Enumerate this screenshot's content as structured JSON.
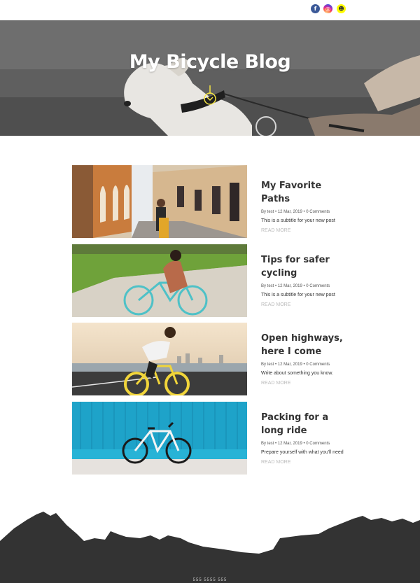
{
  "social": [
    {
      "name": "facebook",
      "glyph": "f"
    },
    {
      "name": "instagram",
      "glyph": "◎"
    },
    {
      "name": "snapchat",
      "glyph": "☻"
    }
  ],
  "hero": {
    "title": "My Bicycle Blog",
    "scroll_icon": "scroll-down-icon"
  },
  "posts": [
    {
      "title": "My Favorite Paths",
      "meta": "By test • 12 Mar, 2019 • 0 Comments",
      "subtitle": "This is a subtitle for your new post",
      "read_more": "READ MORE"
    },
    {
      "title": "Tips for safer cycling",
      "meta": "By test • 12 Mar, 2019 • 0 Comments",
      "subtitle": "This is a subtitle for your new post",
      "read_more": "READ MORE"
    },
    {
      "title": "Open highways, here I come",
      "meta": "By test • 12 Mar, 2019 • 0 Comments",
      "subtitle": "Write about something you know.",
      "read_more": "READ MORE"
    },
    {
      "title": "Packing for a long ride",
      "meta": "By test • 12 Mar, 2019 • 0 Comments",
      "subtitle": "Prepare yourself with what you'll need",
      "read_more": "READ MORE"
    }
  ],
  "footer": {
    "text": "555 5555 555"
  },
  "colors": {
    "accent": "#f4e542",
    "footer_bg": "#333333",
    "title_text": "#333333",
    "read_more": "#bbbbbb"
  }
}
